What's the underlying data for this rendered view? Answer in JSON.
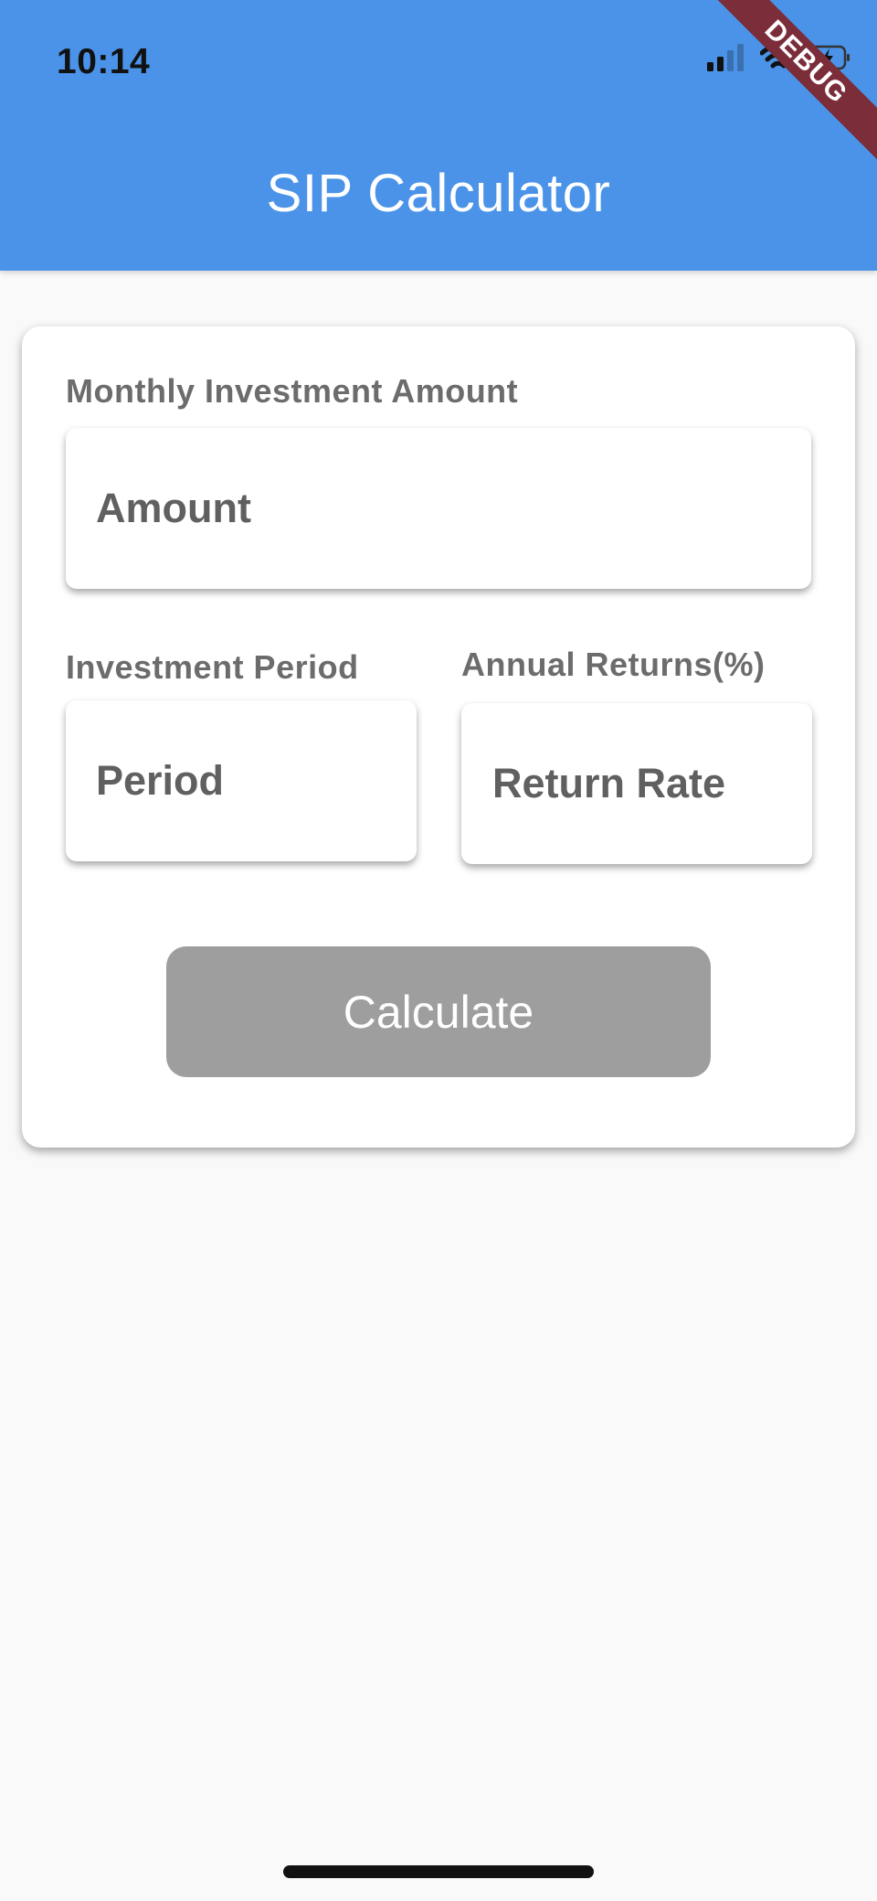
{
  "status_bar": {
    "time": "10:14",
    "icons": [
      "cellular-signal-icon",
      "wifi-icon",
      "battery-charging-icon"
    ]
  },
  "app_bar": {
    "title": "SIP Calculator",
    "color": "#4a93e8"
  },
  "debug_banner": "DEBUG",
  "form": {
    "monthly_label": "Monthly Investment Amount",
    "amount_placeholder": "Amount",
    "amount_value": "",
    "period_label": "Investment Period",
    "period_placeholder": "Period",
    "period_value": "",
    "returns_label": "Annual Returns(%)",
    "returns_placeholder": "Return Rate",
    "returns_value": "",
    "calculate_label": "Calculate",
    "button_color": "#9e9e9e"
  }
}
